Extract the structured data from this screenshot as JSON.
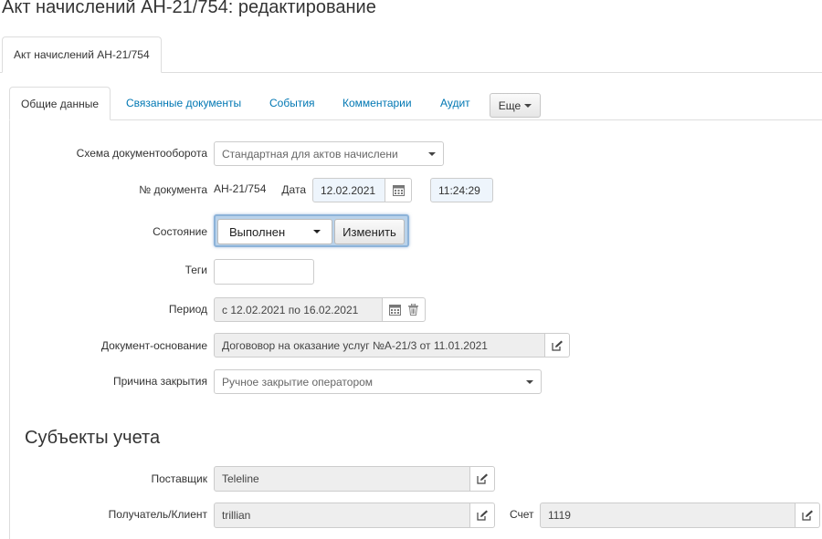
{
  "page": {
    "title": "Акт начислений АН-21/754: редактирование"
  },
  "outer_tabs": [
    {
      "label": "Акт начислений АН-21/754"
    }
  ],
  "inner_tabs": {
    "items": [
      {
        "label": "Общие данные"
      },
      {
        "label": "Связанные документы"
      },
      {
        "label": "События"
      },
      {
        "label": "Комментарии"
      },
      {
        "label": "Аудит"
      }
    ],
    "more_label": "Еще"
  },
  "form": {
    "workflow": {
      "label": "Схема документооборота",
      "value": "Стандартная для актов начислени"
    },
    "doc_number": {
      "label": "№ документа",
      "value": "АН-21/754"
    },
    "date": {
      "label": "Дата",
      "value": "12.02.2021",
      "time": "11:24:29"
    },
    "state": {
      "label": "Состояние",
      "value": "Выполнен",
      "change_label": "Изменить"
    },
    "tags": {
      "label": "Теги",
      "value": ""
    },
    "period": {
      "label": "Период",
      "value": "с 12.02.2021 по 16.02.2021"
    },
    "base_document": {
      "label": "Документ-основание",
      "value": "Догововор на оказание услуг №А-21/3 от 11.01.2021"
    },
    "close_reason": {
      "label": "Причина закрытия",
      "value": "Ручное закрытие оператором"
    }
  },
  "accounting": {
    "section_title": "Субъекты учета",
    "supplier": {
      "label": "Поставщик",
      "value": "Teleline"
    },
    "recipient": {
      "label": "Получатель/Клиент",
      "value": "trillian"
    },
    "account": {
      "label": "Счет",
      "value": "1119"
    }
  },
  "colors": {
    "link": "#0077b3",
    "readonly_bg": "#eeeeee",
    "focus_border": "#8db3d9"
  },
  "icons": [
    "calendar-icon",
    "trash-icon",
    "edit-icon",
    "caret-down-icon"
  ]
}
